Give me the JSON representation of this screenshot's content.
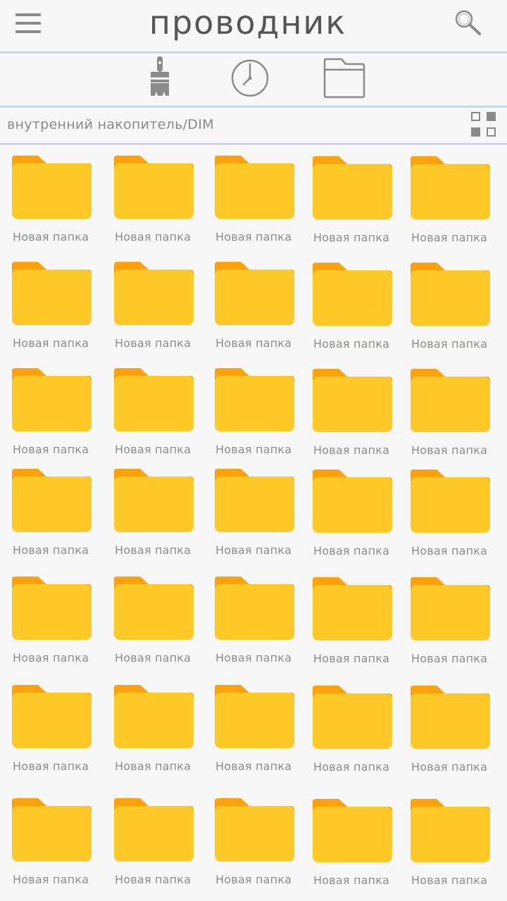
{
  "header": {
    "title": "проводник",
    "menu_icon": "hamburger-menu-icon",
    "search_icon": "search-icon"
  },
  "toolbar": {
    "icons": [
      "brush-icon",
      "clock-icon",
      "folder-icon"
    ]
  },
  "path": {
    "text": "внутренний накопитель/DIM",
    "view_toggle_icon": "grid-view-icon"
  },
  "colors": {
    "background": "#f7f7f7",
    "divider": "#c9d5e8",
    "folder_front": "#ffc928",
    "folder_back": "#ffa00d",
    "icon_gray": "#8a8a8a"
  },
  "folders": [
    {
      "label": "Новая папка"
    },
    {
      "label": "Новая папка"
    },
    {
      "label": "Новая папка"
    },
    {
      "label": "Новая папка"
    },
    {
      "label": "Новая папка"
    },
    {
      "label": "Новая папка"
    },
    {
      "label": "Новая папка"
    },
    {
      "label": "Новая папка"
    },
    {
      "label": "Новая папка"
    },
    {
      "label": "Новая папка"
    },
    {
      "label": "Новая папка"
    },
    {
      "label": "Новая папка"
    },
    {
      "label": "Новая папка"
    },
    {
      "label": "Новая папка"
    },
    {
      "label": "Новая папка"
    },
    {
      "label": "Новая папка"
    },
    {
      "label": "Новая папка"
    },
    {
      "label": "Новая папка"
    },
    {
      "label": "Новая папка"
    },
    {
      "label": "Новая папка"
    },
    {
      "label": "Новая папка"
    },
    {
      "label": "Новая папка"
    },
    {
      "label": "Новая папка"
    },
    {
      "label": "Новая папка"
    },
    {
      "label": "Новая папка"
    },
    {
      "label": "Новая папка"
    },
    {
      "label": "Новая папка"
    },
    {
      "label": "Новая папка"
    },
    {
      "label": "Новая папка"
    },
    {
      "label": "Новая папка"
    },
    {
      "label": "Новая папка"
    },
    {
      "label": "Новая папка"
    },
    {
      "label": "Новая папка"
    },
    {
      "label": "Новая папка"
    },
    {
      "label": "Новая папка"
    }
  ]
}
